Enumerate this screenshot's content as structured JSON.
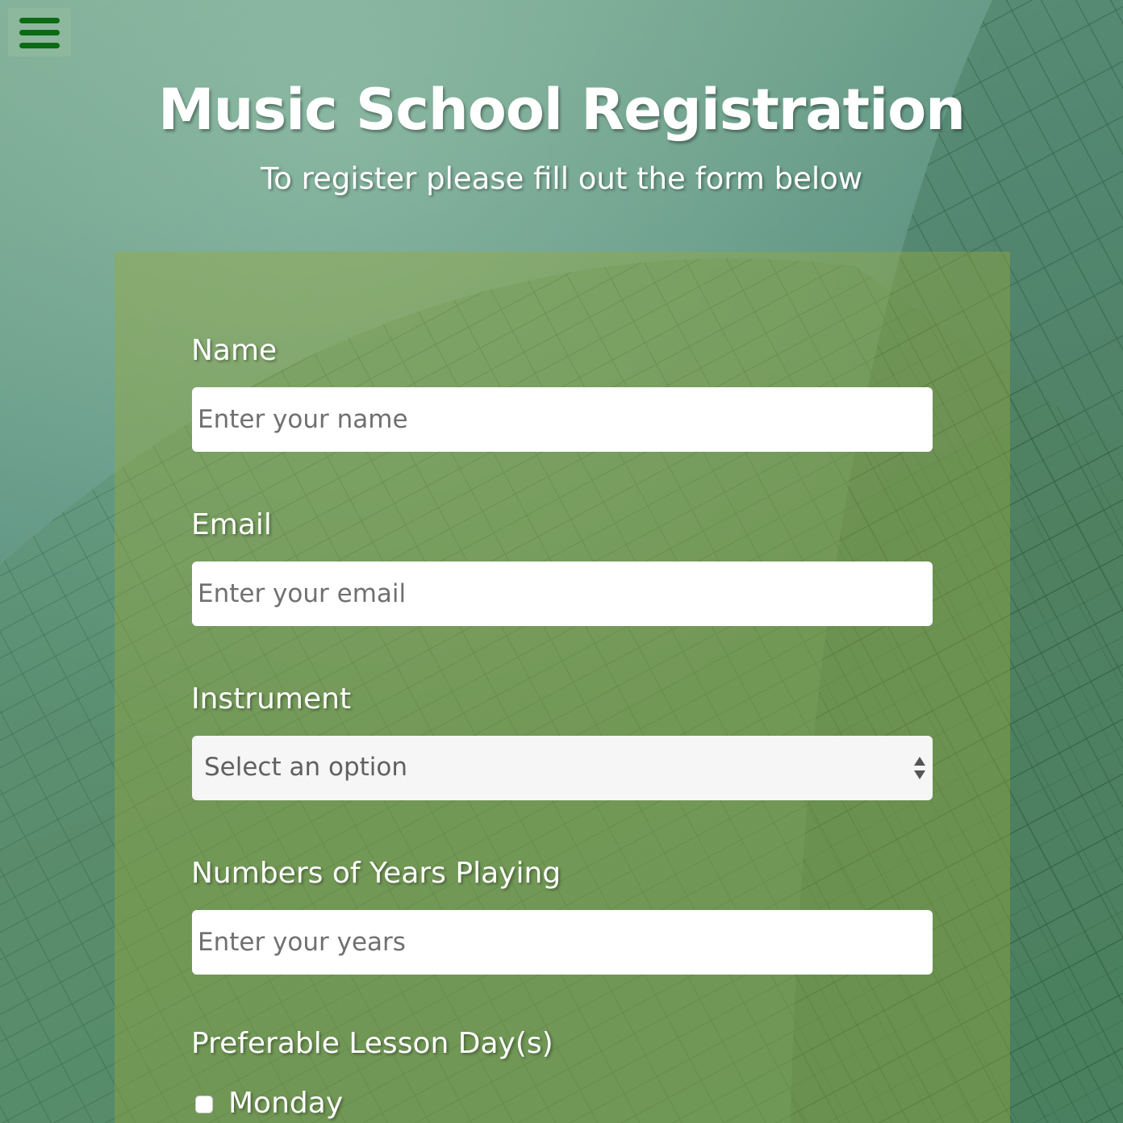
{
  "menu": {
    "icon": "hamburger-menu-icon"
  },
  "header": {
    "title": "Music School Registration",
    "subtitle": "To register please fill out the form below"
  },
  "form": {
    "name": {
      "label": "Name",
      "placeholder": "Enter your name",
      "value": ""
    },
    "email": {
      "label": "Email",
      "placeholder": "Enter your email",
      "value": ""
    },
    "instrument": {
      "label": "Instrument",
      "selected": "Select an option",
      "icon": "select-arrows-icon"
    },
    "years": {
      "label": "Numbers of Years Playing",
      "placeholder": "Enter your years",
      "value": ""
    },
    "lesson_days": {
      "label": "Preferable Lesson Day(s)",
      "options": [
        {
          "label": "Monday",
          "checked": false
        }
      ]
    }
  },
  "colors": {
    "menu_bar": "#0b6b13",
    "text": "#ffffff",
    "panel_overlay": "rgba(150,170,60,0.42)",
    "input_bg": "#ffffff",
    "select_bg": "#f6f6f6"
  }
}
